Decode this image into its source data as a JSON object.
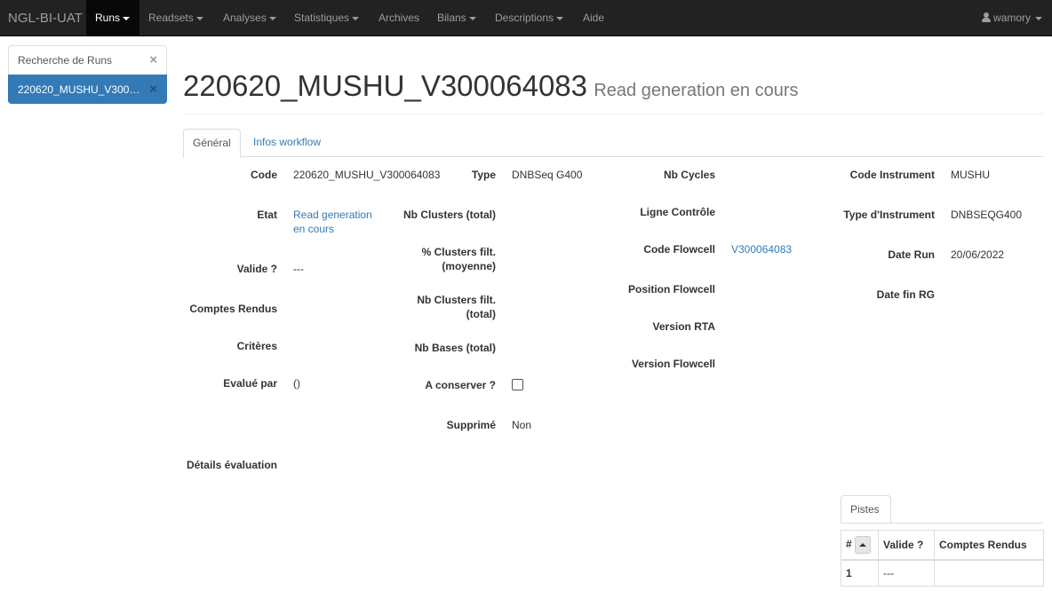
{
  "navbar": {
    "brand": "NGL-BI-UAT",
    "items": [
      {
        "label": "Runs",
        "dropdown": true
      },
      {
        "label": "Readsets",
        "dropdown": true
      },
      {
        "label": "Analyses",
        "dropdown": true
      },
      {
        "label": "Statistiques",
        "dropdown": true
      },
      {
        "label": "Archives",
        "dropdown": false
      },
      {
        "label": "Bilans",
        "dropdown": true
      },
      {
        "label": "Descriptions",
        "dropdown": true
      },
      {
        "label": "Aide",
        "dropdown": false
      }
    ],
    "user": "wamory"
  },
  "sidebar": {
    "items": [
      {
        "label": "Recherche de Runs",
        "close": "×"
      },
      {
        "label": "220620_MUSHU_V300064083",
        "close": "×"
      }
    ]
  },
  "header": {
    "title": "220620_MUSHU_V300064083",
    "subtitle": "Read generation en cours"
  },
  "tabs": [
    "Général",
    "Infos workflow"
  ],
  "fields": {
    "code": {
      "label": "Code",
      "value": "220620_MUSHU_V300064083"
    },
    "etat": {
      "label": "Etat",
      "value_line1": "Read generation",
      "value_line2": "en cours"
    },
    "valide": {
      "label": "Valide ?",
      "value": "---"
    },
    "comptes_rendus": {
      "label": "Comptes Rendus"
    },
    "criteres": {
      "label": "Critères"
    },
    "evalue_par": {
      "label": "Evalué par",
      "value": "()"
    },
    "details_evaluation": {
      "label": "Détails évaluation"
    },
    "type": {
      "label": "Type",
      "value": "DNBSeq G400"
    },
    "nb_clusters_total": {
      "label": "Nb Clusters (total)"
    },
    "pct_clusters_filt": {
      "label_line1": "% Clusters filt.",
      "label_line2": "(moyenne)"
    },
    "nb_clusters_filt": {
      "label_line1": "Nb Clusters filt.",
      "label_line2": "(total)"
    },
    "nb_bases": {
      "label": "Nb Bases (total)"
    },
    "a_conserver": {
      "label": "A conserver ?",
      "checked": false
    },
    "supprime": {
      "label": "Supprimé",
      "value": "Non"
    },
    "nb_cycles": {
      "label": "Nb Cycles"
    },
    "ligne_controle": {
      "label": "Ligne Contrôle"
    },
    "code_flowcell": {
      "label": "Code Flowcell",
      "value": "V300064083"
    },
    "position_flowcell": {
      "label": "Position Flowcell"
    },
    "version_rta": {
      "label": "Version RTA"
    },
    "version_flowcell": {
      "label": "Version Flowcell"
    },
    "code_instrument": {
      "label": "Code Instrument",
      "value": "MUSHU"
    },
    "type_instrument": {
      "label": "Type d'Instrument",
      "value": "DNBSEQG400"
    },
    "date_run": {
      "label": "Date Run",
      "value": "20/06/2022"
    },
    "date_fin_rg": {
      "label": "Date fin RG"
    }
  },
  "pistes": {
    "tab_label": "Pistes",
    "columns": [
      "#",
      "Valide ?",
      "Comptes Rendus"
    ],
    "rows": [
      {
        "num": "1",
        "valide": "---",
        "comptes_rendus": ""
      }
    ]
  }
}
